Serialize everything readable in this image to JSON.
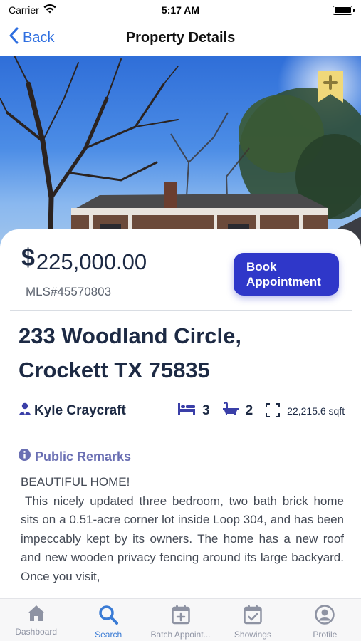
{
  "status_bar": {
    "carrier": "Carrier",
    "time": "5:17 AM"
  },
  "nav": {
    "back_label": "Back",
    "title": "Property Details"
  },
  "hero": {
    "image_subject": "house-exterior-photo",
    "bookmark_icon": "bookmark-plus-icon"
  },
  "listing": {
    "price_symbol": "$",
    "price": "225,000.00",
    "mls": "MLS#45570803",
    "book_label": "Book Appointment",
    "address_line1": "233 Woodland Circle,",
    "address_line2": "Crockett TX 75835",
    "agent": "Kyle Craycraft",
    "bedrooms": "3",
    "bathrooms": "2",
    "sqft": "22,215.6 sqft"
  },
  "remarks": {
    "heading": "Public Remarks",
    "title": "BEAUTIFUL HOME!",
    "text": "This nicely updated three bedroom, two bath brick home sits on a 0.51-acre corner lot inside Loop 304, and has been impeccably kept by its owners. The home has a new roof and new wooden privacy fencing around its large backyard. Once you visit,"
  },
  "tabs": [
    {
      "label": "Dashboard",
      "icon": "house-icon",
      "active": false
    },
    {
      "label": "Search",
      "icon": "search-icon",
      "active": true
    },
    {
      "label": "Batch Appoint...",
      "icon": "calendar-plus-icon",
      "active": false
    },
    {
      "label": "Showings",
      "icon": "calendar-check-icon",
      "active": false
    },
    {
      "label": "Profile",
      "icon": "profile-icon",
      "active": false
    }
  ],
  "colors": {
    "accent": "#2f37c9",
    "link": "#2f6fe0",
    "active_tab": "#3a7bd5",
    "remarks_heading": "#6a6fb3",
    "bookmark": "#f0d87a"
  }
}
